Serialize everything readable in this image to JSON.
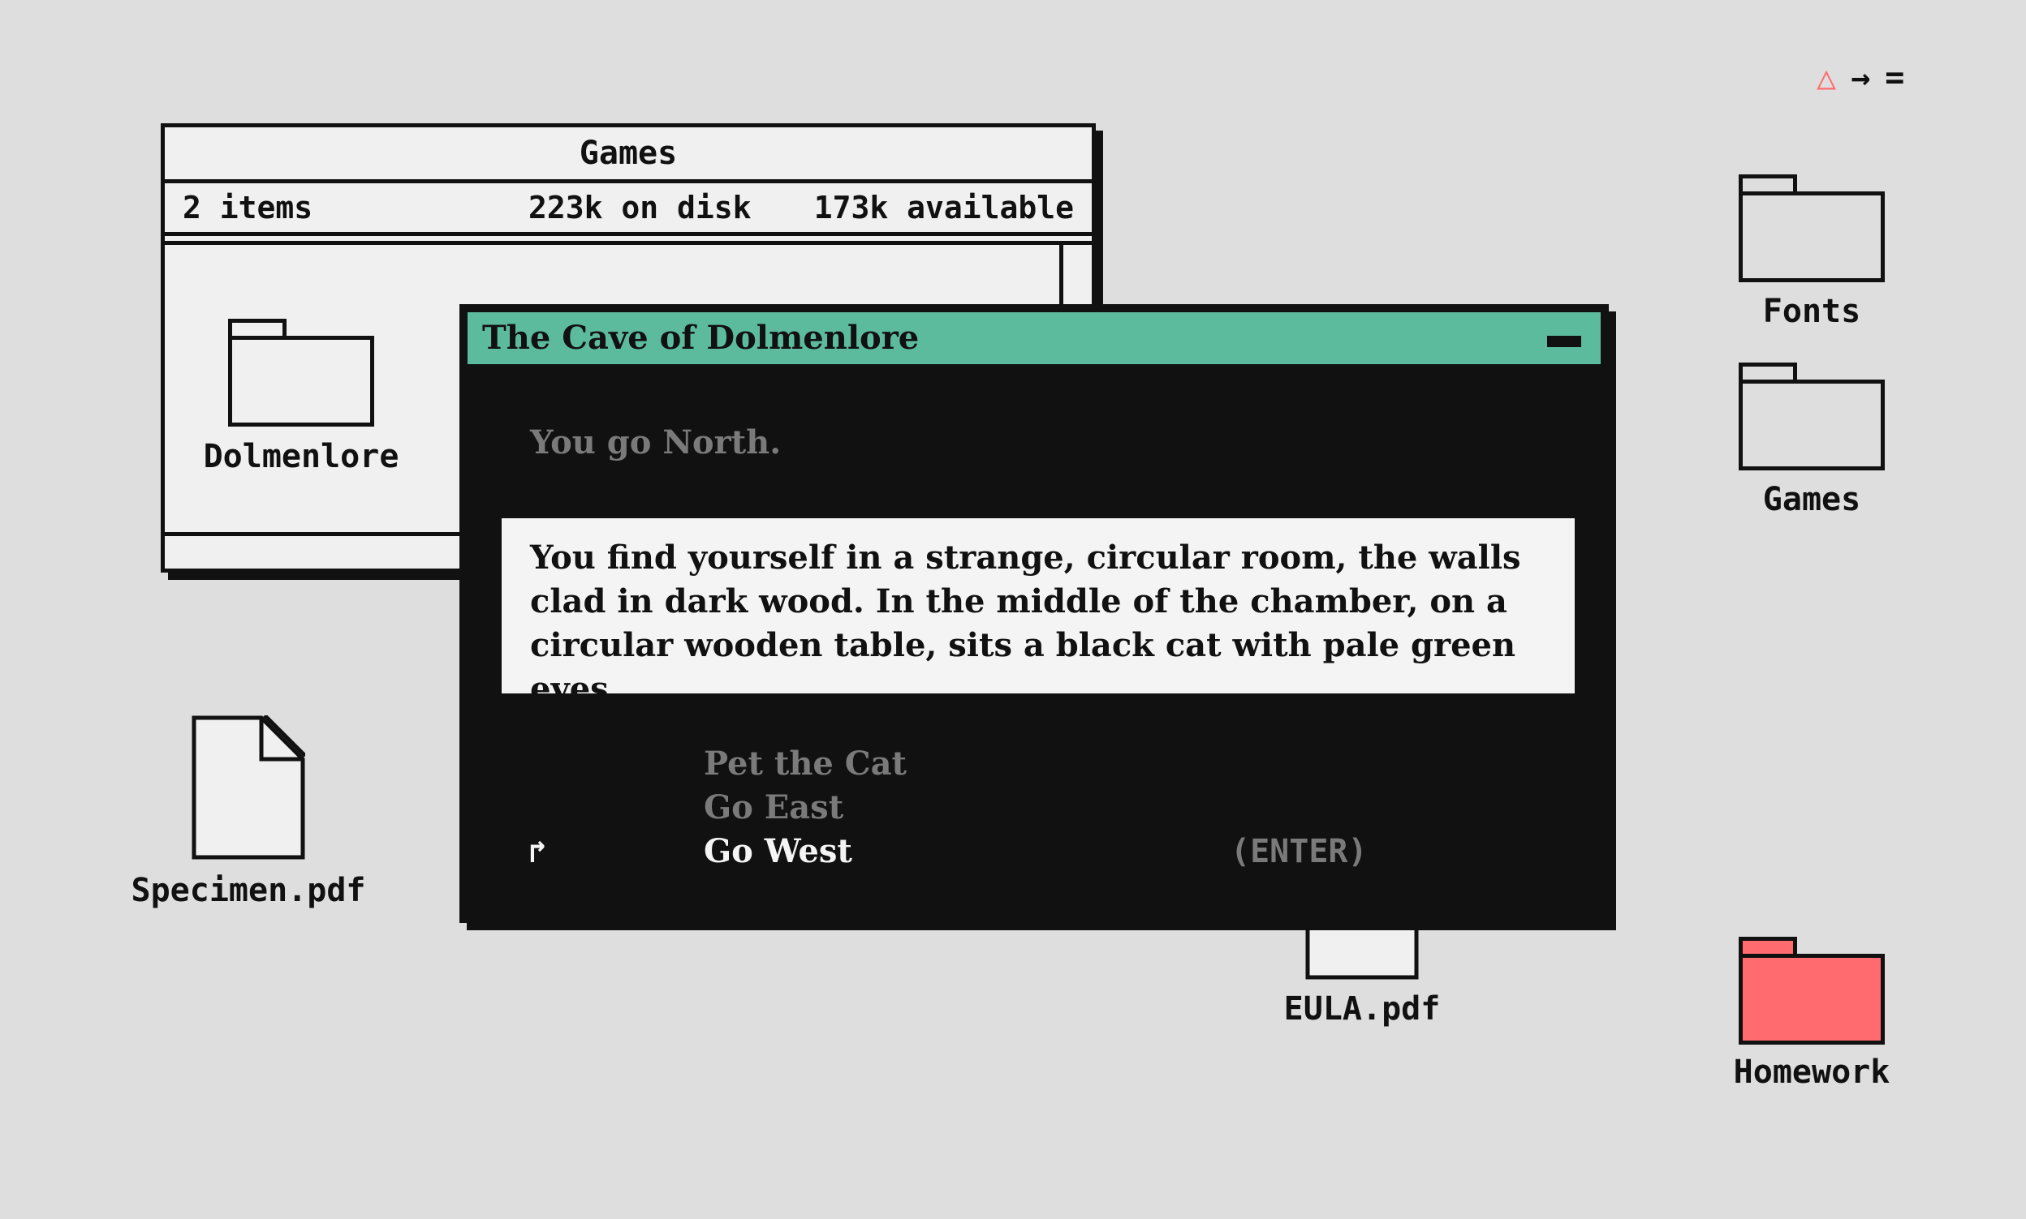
{
  "status_bar": {
    "alert_icon": "alert-triangle-icon",
    "arrow_icon": "arrow-right-icon",
    "menu_icon": "menu-icon",
    "alert_color": "#ff6b6e"
  },
  "finder_window": {
    "title": "Games",
    "item_count": "2 items",
    "disk_used": "223k on disk",
    "disk_available": "173k available",
    "folder_label": "Dolmenlore"
  },
  "game_window": {
    "title": "The Cave of Dolmenlore",
    "title_bar_color": "#5dbb9d",
    "previous_line": "You go North.",
    "narration": "You find yourself in a strange, circular room, the walls clad in dark wood. In the middle of the chamber, on a circular wooden table, sits a black cat with pale green eyes.",
    "choices": [
      {
        "label": "Pet the Cat",
        "selected": false
      },
      {
        "label": "Go East",
        "selected": false
      },
      {
        "label": "Go West",
        "selected": true
      }
    ],
    "cursor_glyph": "↱",
    "enter_hint": "(ENTER)"
  },
  "desktop": {
    "icons": [
      {
        "label": "Fonts",
        "type": "folder"
      },
      {
        "label": "Games",
        "type": "folder"
      },
      {
        "label": "Homework",
        "type": "folder",
        "color": "#ff6b6e"
      },
      {
        "label": "Specimen.pdf",
        "type": "document"
      },
      {
        "label": "EULA.pdf",
        "type": "document"
      }
    ]
  }
}
